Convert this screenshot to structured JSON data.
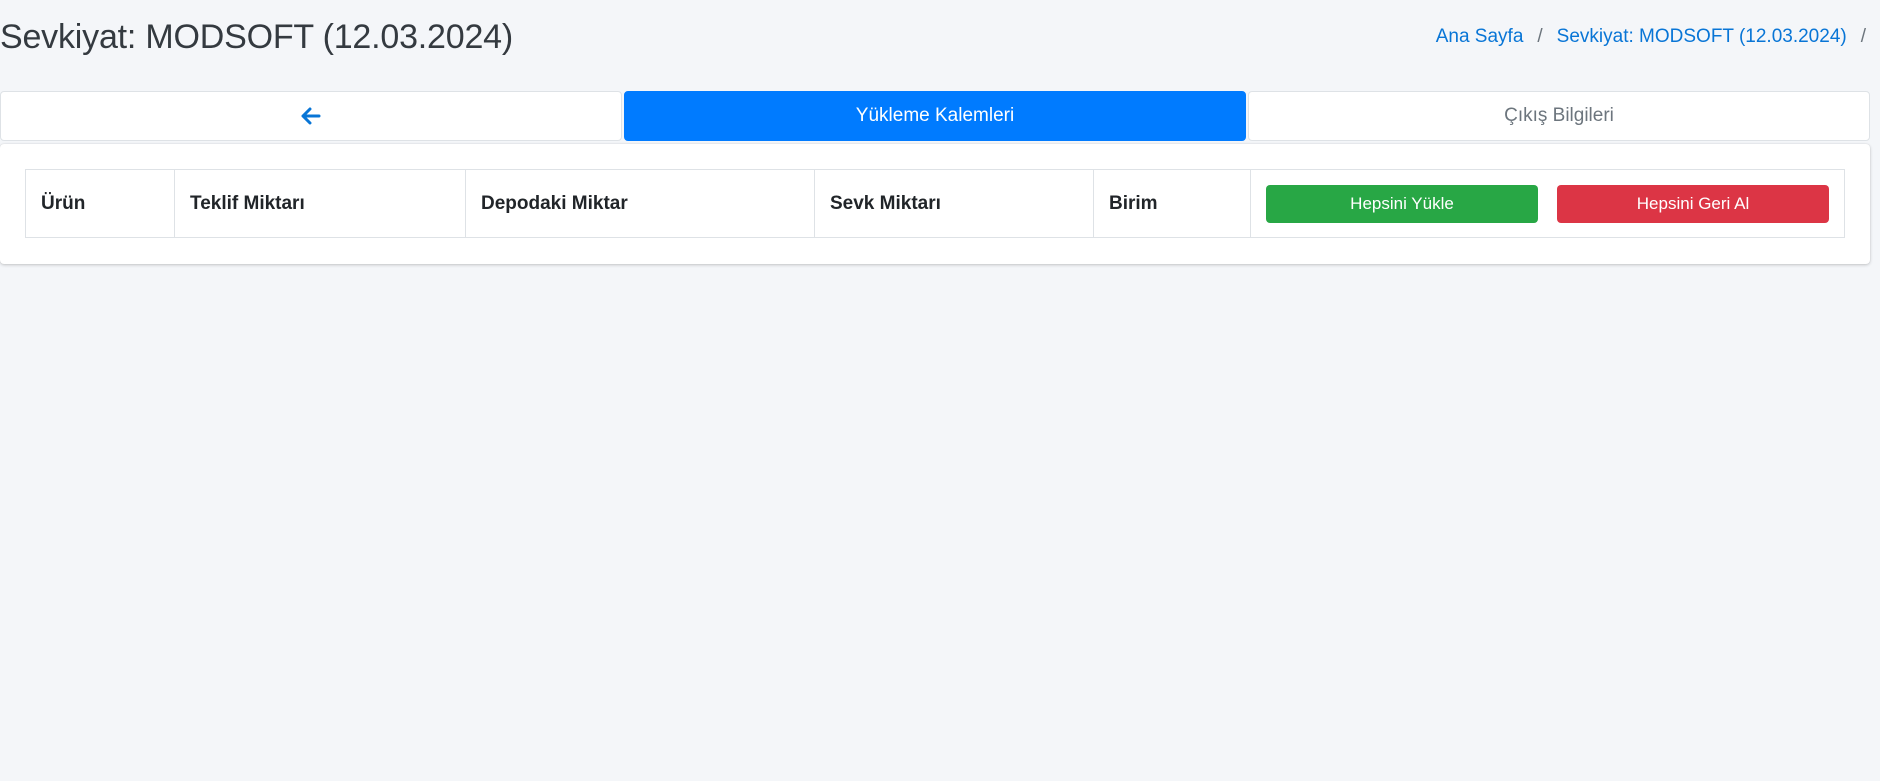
{
  "header": {
    "title": "Sevkiyat: MODSOFT (12.03.2024)"
  },
  "breadcrumb": {
    "items": [
      "Ana Sayfa",
      "Sevkiyat: MODSOFT (12.03.2024)"
    ],
    "separator": "/"
  },
  "tabs": {
    "back_icon": "arrow-left-icon",
    "items": [
      "Yükleme Kalemleri",
      "Çıkış Bilgileri"
    ],
    "active_index": 0
  },
  "table": {
    "columns": [
      "Ürün",
      "Teklif Miktarı",
      "Depodaki Miktar",
      "Sevk Miktarı",
      "Birim"
    ],
    "rows": []
  },
  "actions": {
    "load_all_label": "Hepsini Yükle",
    "revert_all_label": "Hepsini Geri Al"
  },
  "colors": {
    "primary": "#007bff",
    "success": "#28a745",
    "danger": "#dc3545",
    "link": "#0875d6",
    "background": "#f4f6f9"
  }
}
